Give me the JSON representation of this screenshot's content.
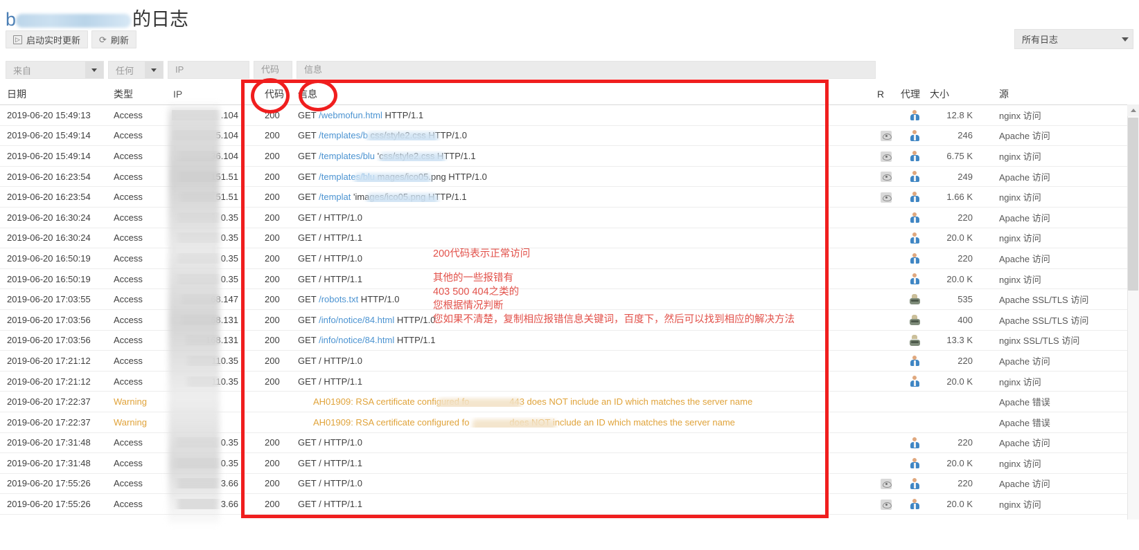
{
  "header": {
    "title_prefix": "b",
    "title_suffix": "的日志",
    "redacted": true
  },
  "toolbar": {
    "start_live_update": "启动实时更新",
    "refresh": "刷新",
    "play_icon": "▷",
    "refresh_icon": "⟳"
  },
  "log_select": {
    "value": "所有日志"
  },
  "filters": {
    "from_placeholder": "来自",
    "any_placeholder": "任何",
    "ip_placeholder": "IP",
    "code_placeholder": "代码",
    "message_placeholder": "信息"
  },
  "table": {
    "columns": {
      "date": "日期",
      "type": "类型",
      "ip": "IP",
      "code": "代码",
      "message": "信息",
      "r": "R",
      "agent": "代理",
      "size": "大小",
      "source": "源"
    },
    "rows": [
      {
        "date": "2019-06-20 15:49:13",
        "type": "Access",
        "ip": ".104",
        "code": "200",
        "msg_pre": "GET ",
        "msg_link": "/webmofun.html",
        "msg_post": " HTTP/1.1",
        "r": false,
        "agent": "user",
        "size": "12.8 K",
        "source": "nginx 访问"
      },
      {
        "date": "2019-06-20 15:49:14",
        "type": "Access",
        "ip": "5.104",
        "code": "200",
        "msg_pre": "GET ",
        "msg_link": "/templates/b",
        "msg_post": "css/style2.css HTTP/1.0",
        "msg_blur": true,
        "r": true,
        "agent": "user",
        "size": "246",
        "source": "Apache 访问"
      },
      {
        "date": "2019-06-20 15:49:14",
        "type": "Access",
        "ip": "36.104",
        "code": "200",
        "msg_pre": "GET ",
        "msg_link": "/templates/blu",
        "msg_post": "'css/style2.css HTTP/1.1",
        "msg_blur": true,
        "r": true,
        "agent": "user",
        "size": "6.75 K",
        "source": "nginx 访问"
      },
      {
        "date": "2019-06-20 16:23:54",
        "type": "Access",
        "ip": "151.51",
        "code": "200",
        "msg_pre": "GET ",
        "msg_link": "/templates/blu",
        "msg_post": "mages/ico05.png HTTP/1.0",
        "msg_blur": true,
        "r": true,
        "agent": "user",
        "size": "249",
        "source": "Apache 访问"
      },
      {
        "date": "2019-06-20 16:23:54",
        "type": "Access",
        "ip": "51.51",
        "code": "200",
        "msg_pre": "GET ",
        "msg_link": "/templat",
        "msg_post": "'images/ico05.png HTTP/1.1",
        "msg_blur": true,
        "r": true,
        "agent": "user",
        "size": "1.66 K",
        "source": "nginx 访问"
      },
      {
        "date": "2019-06-20 16:30:24",
        "type": "Access",
        "ip": "0.35",
        "code": "200",
        "msg_pre": "GET / HTTP/1.0",
        "msg_link": "",
        "msg_post": "",
        "r": false,
        "agent": "user",
        "size": "220",
        "source": "Apache 访问"
      },
      {
        "date": "2019-06-20 16:30:24",
        "type": "Access",
        "ip": "0.35",
        "code": "200",
        "msg_pre": "GET / HTTP/1.1",
        "msg_link": "",
        "msg_post": "",
        "r": false,
        "agent": "user",
        "size": "20.0 K",
        "source": "nginx 访问"
      },
      {
        "date": "2019-06-20 16:50:19",
        "type": "Access",
        "ip": "0.35",
        "code": "200",
        "msg_pre": "GET / HTTP/1.0",
        "msg_link": "",
        "msg_post": "",
        "r": false,
        "agent": "user",
        "size": "220",
        "source": "Apache 访问"
      },
      {
        "date": "2019-06-20 16:50:19",
        "type": "Access",
        "ip": "0.35",
        "code": "200",
        "msg_pre": "GET / HTTP/1.1",
        "msg_link": "",
        "msg_post": "",
        "r": false,
        "agent": "user",
        "size": "20.0 K",
        "source": "nginx 访问"
      },
      {
        "date": "2019-06-20 17:03:55",
        "type": "Access",
        "ip": "68.147",
        "code": "200",
        "msg_pre": "GET ",
        "msg_link": "/robots.txt",
        "msg_post": " HTTP/1.0",
        "r": false,
        "agent": "bot",
        "size": "535",
        "source": "Apache SSL/TLS 访问"
      },
      {
        "date": "2019-06-20 17:03:56",
        "type": "Access",
        "ip": "68.131",
        "code": "200",
        "msg_pre": "GET ",
        "msg_link": "/info/notice/84.html",
        "msg_post": " HTTP/1.0",
        "r": false,
        "agent": "bot",
        "size": "400",
        "source": "Apache SSL/TLS 访问"
      },
      {
        "date": "2019-06-20 17:03:56",
        "type": "Access",
        "ip": "168.131",
        "code": "200",
        "msg_pre": "GET ",
        "msg_link": "/info/notice/84.html",
        "msg_post": " HTTP/1.1",
        "r": false,
        "agent": "bot",
        "size": "13.3 K",
        "source": "nginx SSL/TLS 访问"
      },
      {
        "date": "2019-06-20 17:21:12",
        "type": "Access",
        "ip": "110.35",
        "code": "200",
        "msg_pre": "GET / HTTP/1.0",
        "msg_link": "",
        "msg_post": "",
        "r": false,
        "agent": "user",
        "size": "220",
        "source": "Apache 访问"
      },
      {
        "date": "2019-06-20 17:21:12",
        "type": "Access",
        "ip": "110.35",
        "code": "200",
        "msg_pre": "GET / HTTP/1.1",
        "msg_link": "",
        "msg_post": "",
        "r": false,
        "agent": "user",
        "size": "20.0 K",
        "source": "nginx 访问"
      },
      {
        "date": "2019-06-20 17:22:37",
        "type": "Warning",
        "ip": "",
        "code": "",
        "msg_pre": "AH01909: RSA certificate configured fo",
        "msg_link": "",
        "msg_post": "443 does NOT include an ID which matches the server name",
        "msg_blur": true,
        "warning": true,
        "r": false,
        "agent": "",
        "size": "",
        "source": "Apache 错误"
      },
      {
        "date": "2019-06-20 17:22:37",
        "type": "Warning",
        "ip": "",
        "code": "",
        "msg_pre": "AH01909: RSA certificate configured fo",
        "msg_link": "",
        "msg_post": "does NOT include an ID which matches the server name",
        "msg_blur": true,
        "warning": true,
        "r": false,
        "agent": "",
        "size": "",
        "source": "Apache 错误"
      },
      {
        "date": "2019-06-20 17:31:48",
        "type": "Access",
        "ip": "0.35",
        "code": "200",
        "msg_pre": "GET / HTTP/1.0",
        "msg_link": "",
        "msg_post": "",
        "r": false,
        "agent": "user",
        "size": "220",
        "source": "Apache 访问"
      },
      {
        "date": "2019-06-20 17:31:48",
        "type": "Access",
        "ip": "0.35",
        "code": "200",
        "msg_pre": "GET / HTTP/1.1",
        "msg_link": "",
        "msg_post": "",
        "r": false,
        "agent": "user",
        "size": "20.0 K",
        "source": "nginx 访问"
      },
      {
        "date": "2019-06-20 17:55:26",
        "type": "Access",
        "ip": "3.66",
        "code": "200",
        "msg_pre": "GET / HTTP/1.0",
        "msg_link": "",
        "msg_post": "",
        "r": true,
        "agent": "user",
        "size": "220",
        "source": "Apache 访问"
      },
      {
        "date": "2019-06-20 17:55:26",
        "type": "Access",
        "ip": "3.66",
        "code": "200",
        "msg_pre": "GET / HTTP/1.1",
        "msg_link": "",
        "msg_post": "",
        "r": true,
        "agent": "user",
        "size": "20.0 K",
        "source": "nginx 访问"
      }
    ]
  },
  "annotations": {
    "color": "#e2514a",
    "box_color": "#f01e1e",
    "line1": "200代码表示正常访问",
    "line2a": "其他的一些报错有",
    "line2b": "403  500  404之类的",
    "line2c": "您根据情况判断",
    "line3": "您如果不清楚，复制相应报错信息关键词，百度下，然后可以找到相应的解决方法"
  }
}
